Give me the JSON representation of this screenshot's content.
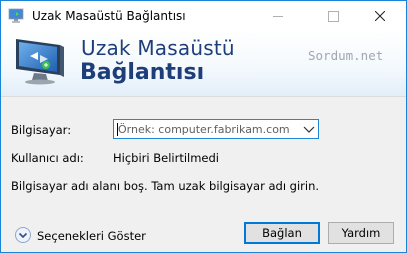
{
  "window": {
    "title": "Uzak Masaüstü Bağlantısı"
  },
  "banner": {
    "line1": "Uzak Masaüstü",
    "line2": "Bağlantısı",
    "watermark": "Sordum.net"
  },
  "form": {
    "computer_label": "Bilgisayar:",
    "computer_placeholder": "Örnek: computer.fabrikam.com",
    "computer_value": "",
    "username_label": "Kullanıcı adı:",
    "username_value": "Hiçbiri Belirtilmedi",
    "message": "Bilgisayar adı alanı boş. Tam uzak bilgisayar adı girin."
  },
  "footer": {
    "options_label": "Seçenekleri Göster",
    "connect_label": "Bağlan",
    "help_label": "Yardım"
  },
  "icons": {
    "app": "remote-desktop-icon",
    "banner": "remote-desktop-monitor-icon",
    "options": "expand-chevron-icon",
    "dropdown": "chevron-down-icon"
  },
  "colors": {
    "accent": "#0078d7",
    "title_text": "#1e3e7a"
  }
}
